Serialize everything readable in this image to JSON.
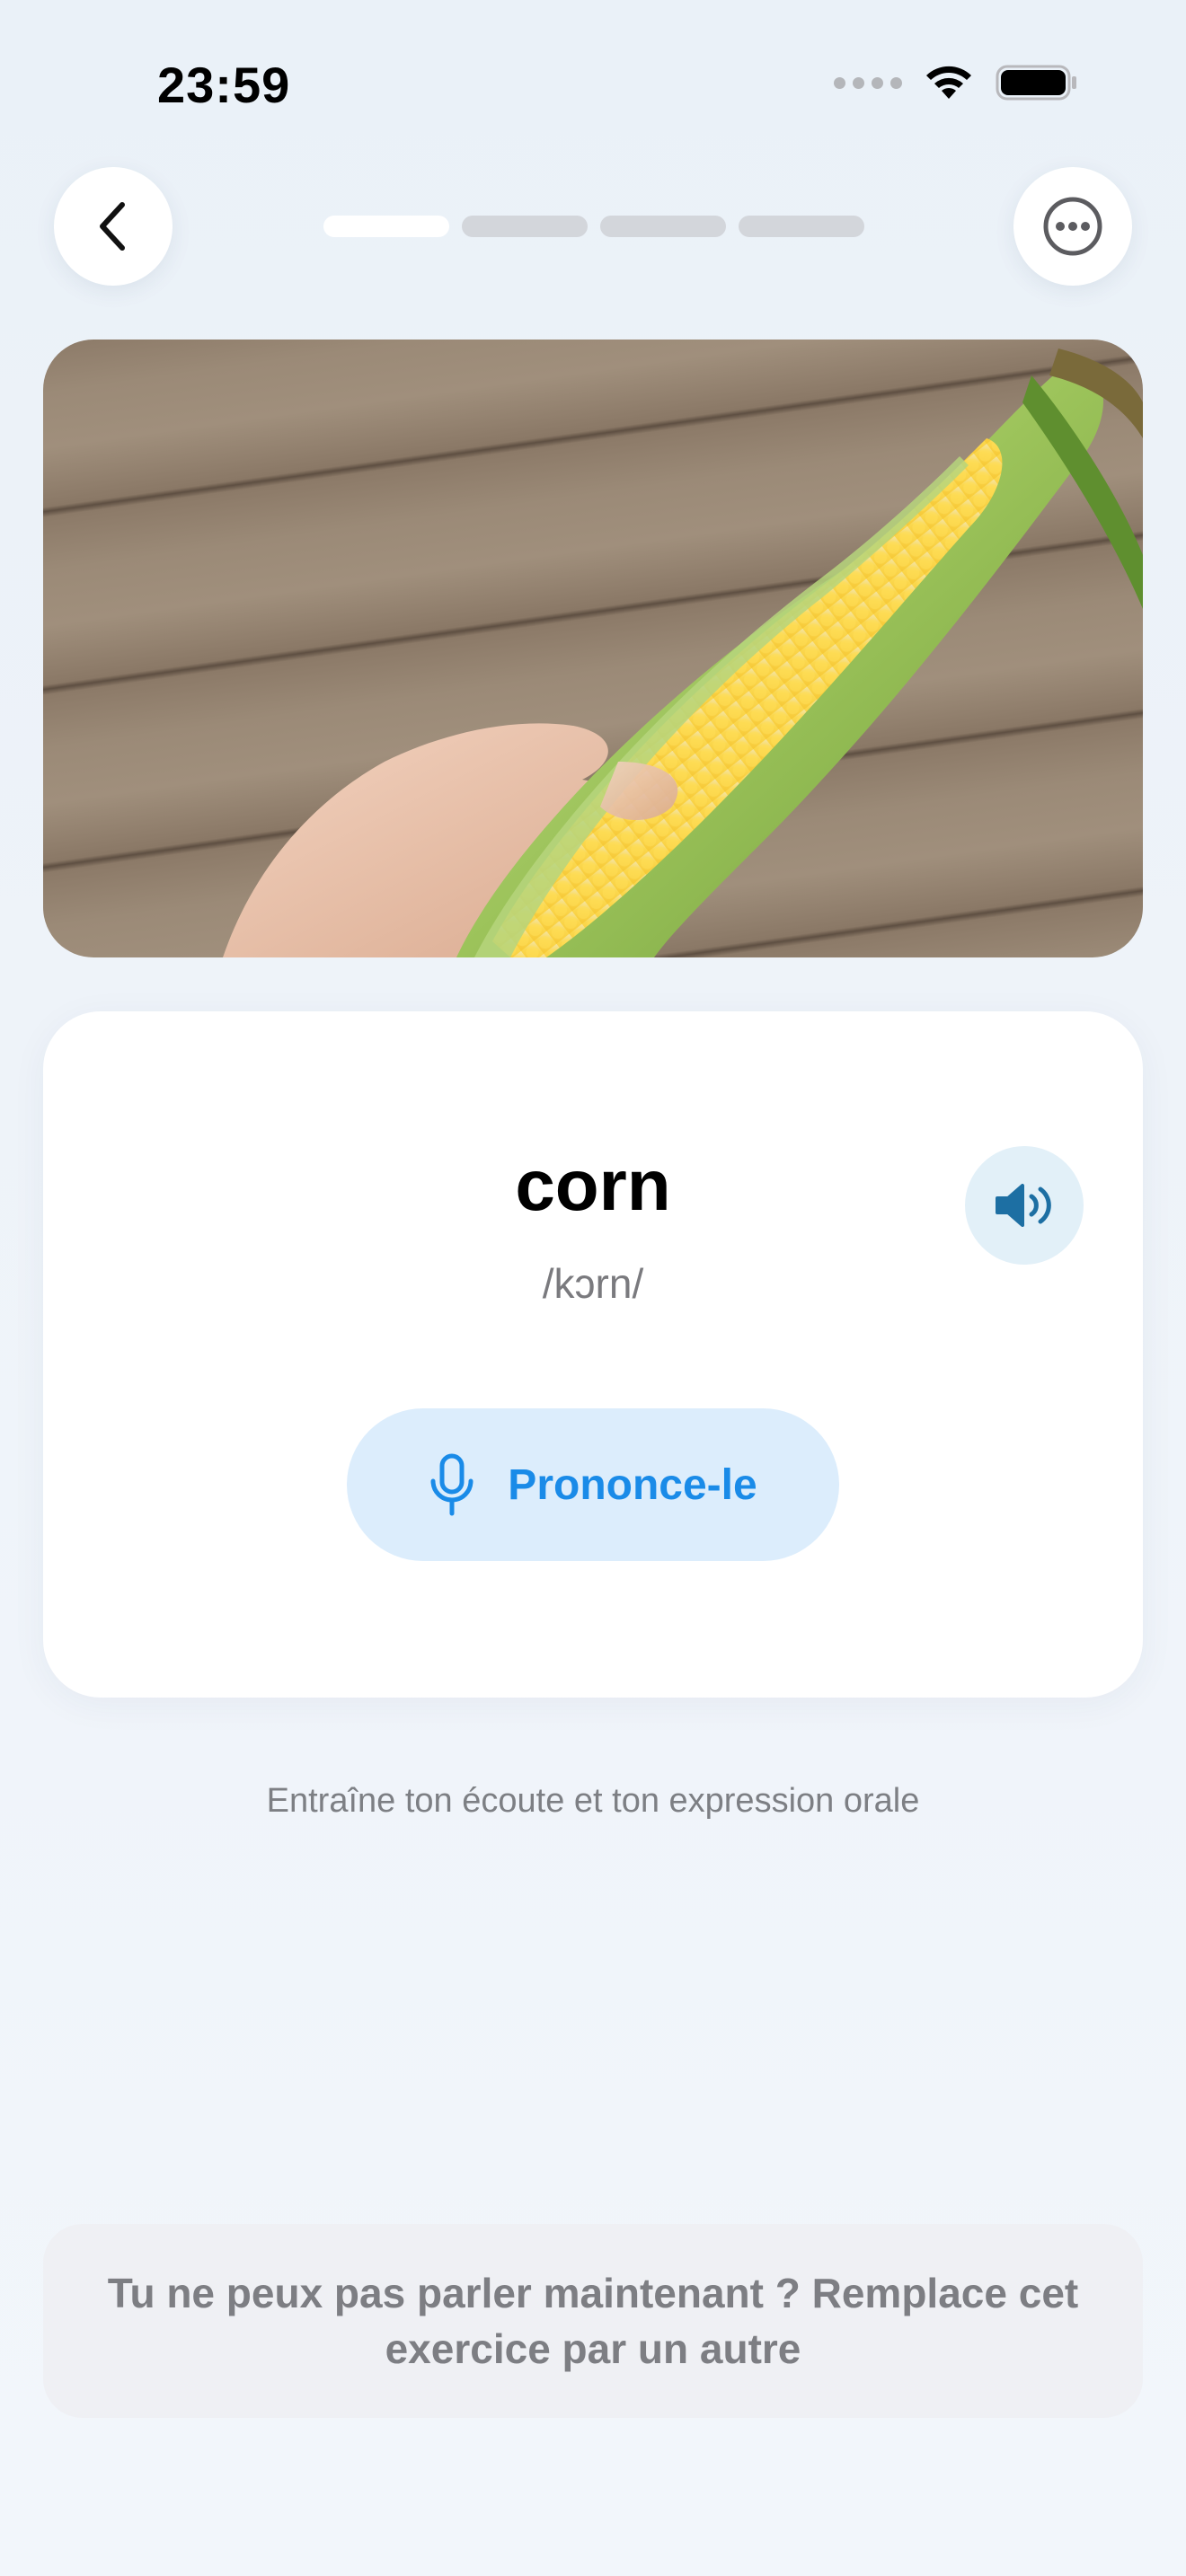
{
  "status_bar": {
    "time": "23:59"
  },
  "header": {
    "back_icon": "chevron-left-icon",
    "more_icon": "ellipsis-circle-icon",
    "progress": {
      "total_steps": 4,
      "current_step": 1
    }
  },
  "card": {
    "word": "corn",
    "phonetic": "/kɔrn/",
    "audio_icon": "speaker-icon",
    "pronounce_label": "Prononce-le",
    "pronounce_icon": "microphone-icon"
  },
  "hint": "Entraîne ton écoute et ton expression orale",
  "swap_exercise": "Tu ne peux pas parler maintenant ? Remplace cet exercice par un autre",
  "colors": {
    "accent": "#1a8be8",
    "accent_bg": "#dcedfc",
    "audio_icon": "#1d6fa3",
    "muted_text": "#7d7f84"
  }
}
